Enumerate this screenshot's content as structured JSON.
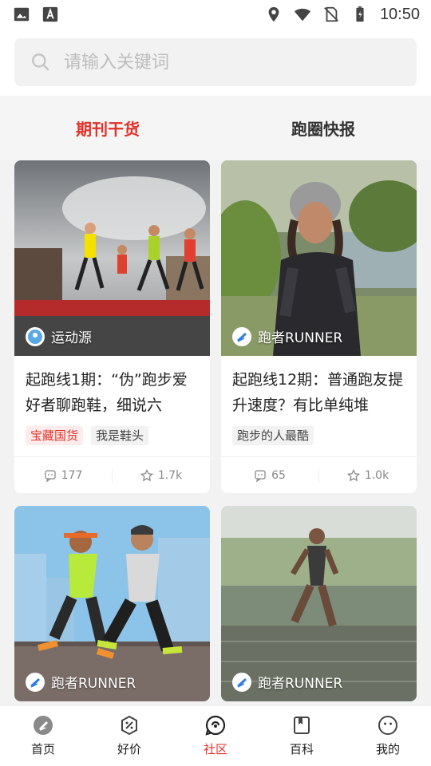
{
  "status_bar": {
    "time": "10:50",
    "icons": [
      "image-icon",
      "a-icon",
      "location-icon",
      "wifi-icon",
      "no-sim-icon",
      "battery-icon"
    ]
  },
  "search": {
    "placeholder": "请输入关键词"
  },
  "tabs": [
    {
      "label": "期刊干货",
      "active": true
    },
    {
      "label": "跑圈快报",
      "active": false
    }
  ],
  "feed": {
    "cards": [
      {
        "source": "运动源",
        "title": "起跑线1期：“伪”跑步爱好者聊跑鞋，细说六",
        "tags": [
          "宝藏国货",
          "我是鞋头"
        ],
        "comments": "177",
        "favorites": "1.7k"
      },
      {
        "source": "跑者RUNNER",
        "title": "起跑线12期：普通跑友提升速度？有比单纯堆",
        "tags": [
          "跑步的人最酷"
        ],
        "comments": "65",
        "favorites": "1.0k"
      },
      {
        "source": "跑者RUNNER"
      },
      {
        "source": "跑者RUNNER"
      }
    ]
  },
  "bottom_nav": [
    {
      "label": "首页",
      "icon": "home-icon",
      "active": false
    },
    {
      "label": "好价",
      "icon": "deal-icon",
      "active": false
    },
    {
      "label": "社区",
      "icon": "community-icon",
      "active": true
    },
    {
      "label": "百科",
      "icon": "encyclopedia-icon",
      "active": false
    },
    {
      "label": "我的",
      "icon": "profile-icon",
      "active": false
    }
  ],
  "colors": {
    "accent": "#e3312a",
    "background": "#f2f2f2"
  }
}
